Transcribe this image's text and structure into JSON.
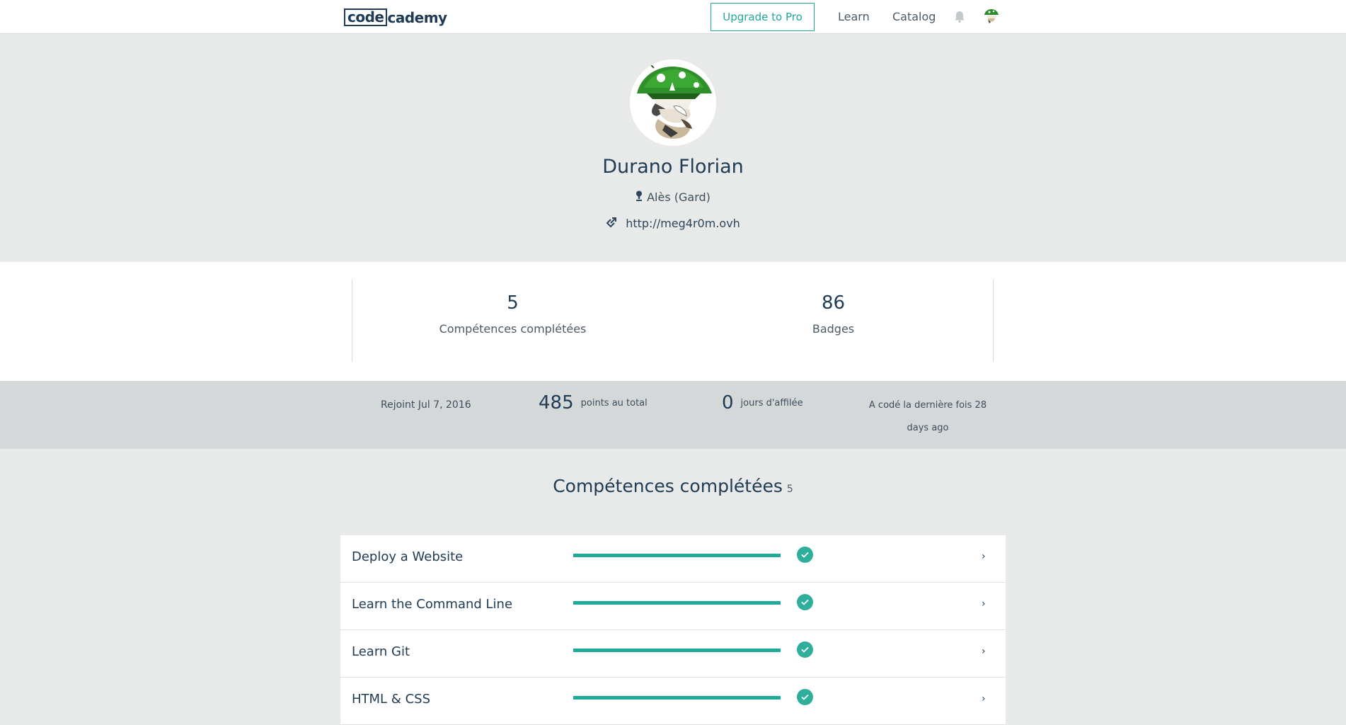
{
  "nav": {
    "logo_box": "code",
    "logo_rest": "cademy",
    "upgrade_label": "Upgrade to Pro",
    "learn_label": "Learn",
    "catalog_label": "Catalog",
    "bell_icon": "bell-icon",
    "avatar_icon": "user-avatar"
  },
  "profile": {
    "name": "Durano Florian",
    "location": "Alès (Gard)",
    "website": "http://meg4r0m.ovh"
  },
  "stats": {
    "skills_count": "5",
    "skills_label": "Compétences complétées",
    "badges_count": "86",
    "badges_label": "Badges"
  },
  "summary": {
    "joined": "Rejoint Jul 7, 2016",
    "points": "485",
    "points_label": "points au total",
    "streak": "0",
    "streak_label": "jours d'affilée",
    "last_coded": "A codé la dernière fois 28 days ago"
  },
  "skills": {
    "title": "Compétences complétées",
    "count": "5",
    "items": [
      {
        "name": "Deploy a Website",
        "progress": 1.0
      },
      {
        "name": "Learn the Command Line",
        "progress": 1.0
      },
      {
        "name": "Learn Git",
        "progress": 1.0
      },
      {
        "name": "HTML & CSS",
        "progress": 1.0
      }
    ]
  },
  "colors": {
    "accent": "#1fa99a",
    "text_dark": "#203c54",
    "band_light": "#e8eaea",
    "band_dark": "#d5d8d9"
  }
}
